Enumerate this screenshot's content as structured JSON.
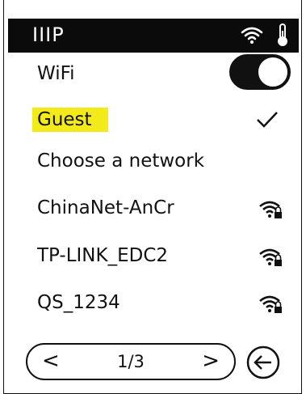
{
  "status_bar": {
    "app_name": "IIIP",
    "wifi_icon": "wifi-icon",
    "thermo_icon": "thermometer-icon",
    "background": "#0b0b0b"
  },
  "wifi": {
    "label": "WiFi",
    "enabled": true
  },
  "connected": {
    "name": "Guest",
    "highlight": "#f3ea1a",
    "icon": "checkmark-icon"
  },
  "choose_label": "Choose a network",
  "networks": [
    {
      "name": "ChinaNet-AnCr",
      "icon": "wifi-locked-icon"
    },
    {
      "name": "TP-LINK_EDC2",
      "icon": "wifi-locked-icon"
    },
    {
      "name": "QS_1234",
      "icon": "wifi-locked-icon"
    }
  ],
  "pager": {
    "prev": "<",
    "page": "1/3",
    "next": ">"
  },
  "back_icon": "back-arrow-icon"
}
